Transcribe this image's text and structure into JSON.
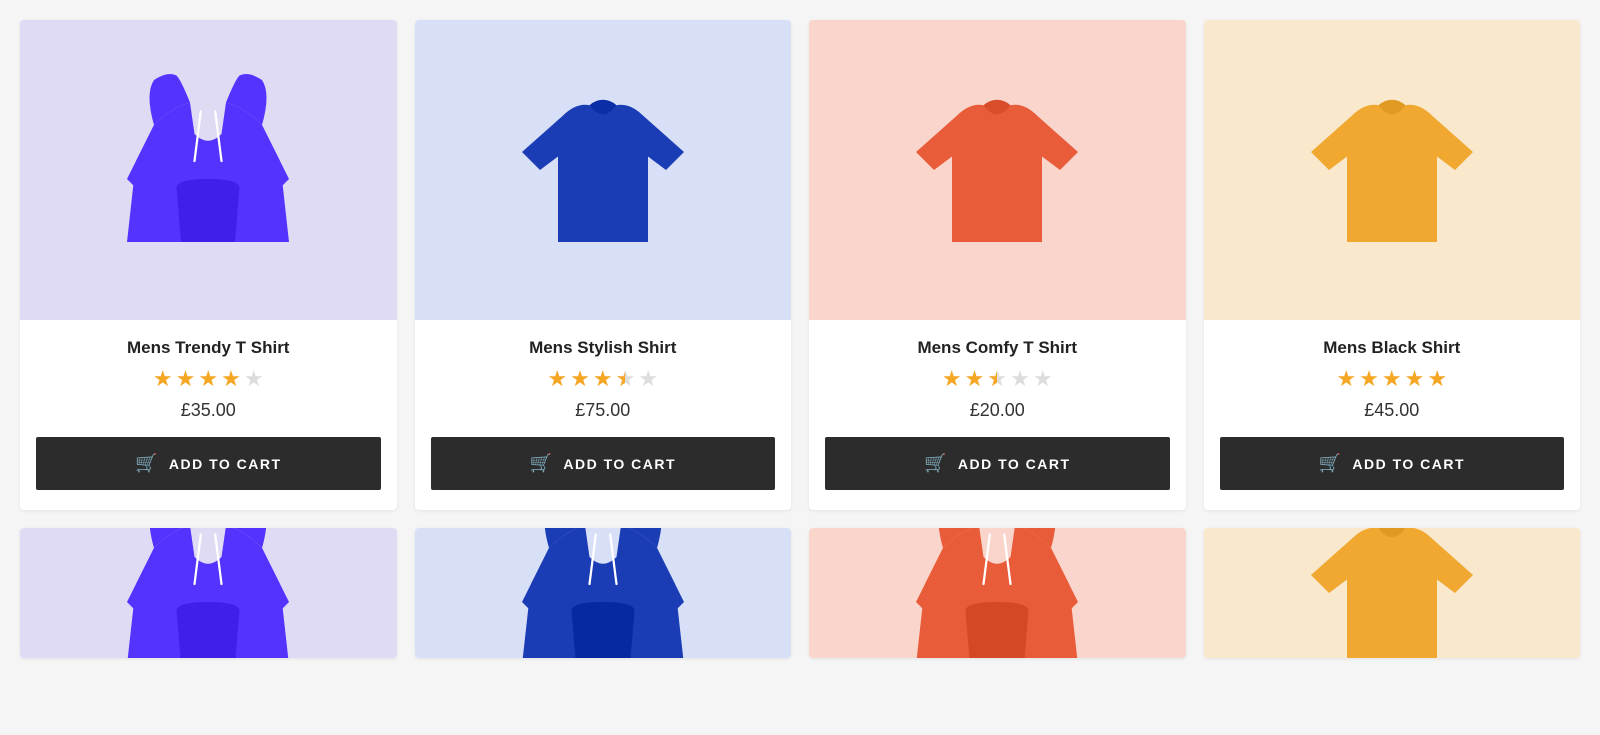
{
  "products": [
    {
      "id": "trendy-tshirt",
      "name": "Mens Trendy T Shirt",
      "price": "£35.00",
      "rating": 4,
      "max_rating": 5,
      "bg_color": "#e0dbf5",
      "shirt_color": "#5533ff",
      "type": "hoodie",
      "button_label": "ADD TO CART"
    },
    {
      "id": "stylish-shirt",
      "name": "Mens Stylish Shirt",
      "price": "£75.00",
      "rating": 3.5,
      "max_rating": 5,
      "bg_color": "#d8e0f7",
      "shirt_color": "#1a3cb5",
      "type": "tshirt",
      "button_label": "ADD TO CART"
    },
    {
      "id": "comfy-tshirt",
      "name": "Mens Comfy T Shirt",
      "price": "£20.00",
      "rating": 2.5,
      "max_rating": 5,
      "bg_color": "#fad5cc",
      "shirt_color": "#e85c3a",
      "type": "tshirt",
      "button_label": "ADD TO CART"
    },
    {
      "id": "black-shirt",
      "name": "Mens Black Shirt",
      "price": "£45.00",
      "rating": 5,
      "max_rating": 5,
      "bg_color": "#fae8cc",
      "shirt_color": "#f0a830",
      "type": "tshirt",
      "button_label": "ADD TO CART"
    }
  ],
  "products_row2": [
    {
      "id": "trendy-tshirt-2",
      "bg_color": "#e0dbf5",
      "shirt_color": "#5533ff",
      "type": "hoodie"
    },
    {
      "id": "stylish-shirt-2",
      "bg_color": "#d8e0f7",
      "shirt_color": "#1a3cb5",
      "type": "hoodie"
    },
    {
      "id": "comfy-tshirt-2",
      "bg_color": "#fad5cc",
      "shirt_color": "#e85c3a",
      "type": "hoodie"
    },
    {
      "id": "black-shirt-2",
      "bg_color": "#fae8cc",
      "shirt_color": "#f0a830",
      "type": "tshirt"
    }
  ],
  "cart_icon": "🛒"
}
